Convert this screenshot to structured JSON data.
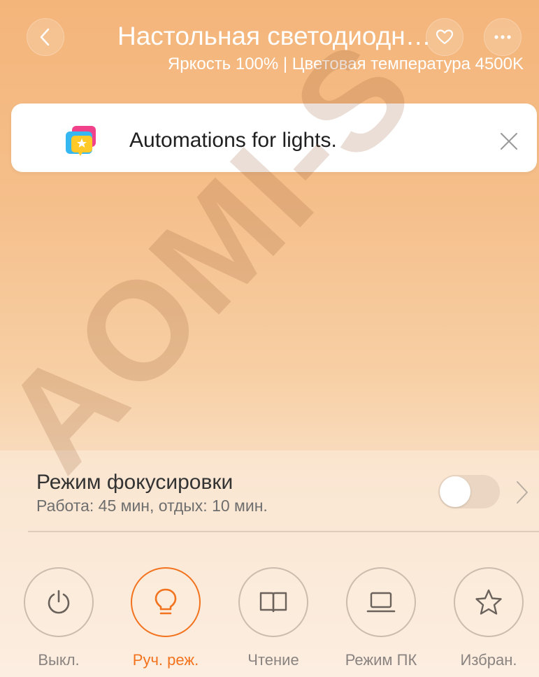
{
  "header": {
    "title": "Настольная светодиодна...",
    "subtitle": "Яркость 100% | Цветовая температура 4500K"
  },
  "banner": {
    "text": "Automations for lights."
  },
  "focus_mode": {
    "title": "Режим фокусировки",
    "subtitle": "Работа: 45 мин, отдых: 10 мин.",
    "enabled": false
  },
  "modes": [
    {
      "label": "Выкл.",
      "icon": "power-icon",
      "active": false
    },
    {
      "label": "Руч. реж.",
      "icon": "bulb-icon",
      "active": true
    },
    {
      "label": "Чтение",
      "icon": "book-icon",
      "active": false
    },
    {
      "label": "Режим ПК",
      "icon": "laptop-icon",
      "active": false
    },
    {
      "label": "Избран.",
      "icon": "star-icon",
      "active": false
    }
  ],
  "watermark": "AOMI-S",
  "colors": {
    "accent": "#f3721d",
    "inactive": "#8a8380"
  }
}
